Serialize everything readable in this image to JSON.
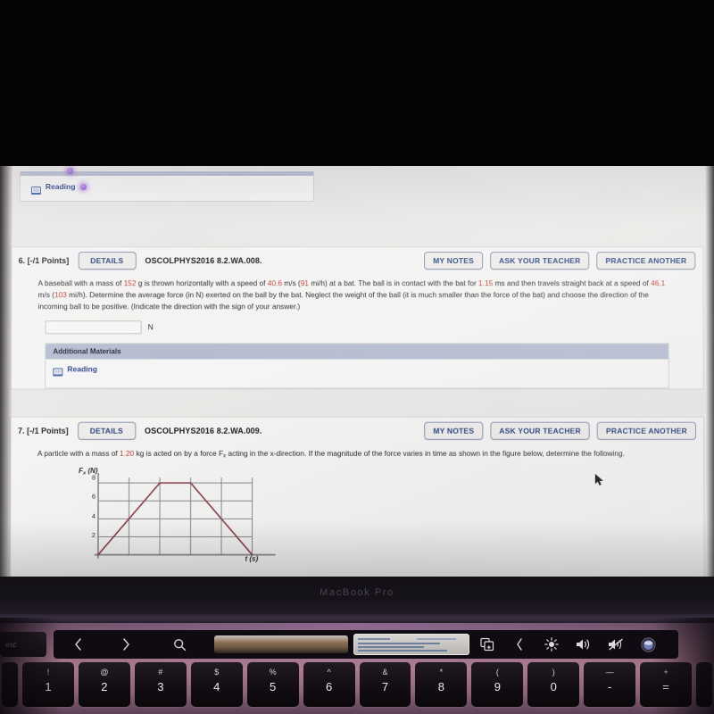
{
  "device": {
    "brand_text": "MacBook Pro",
    "esc_key": "esc"
  },
  "top_partial_card": {
    "reading_label": "Reading",
    "reading_icon": "book-icon"
  },
  "problems": [
    {
      "number": "6.",
      "points": "[-/1 Points]",
      "details_label": "DETAILS",
      "problem_id": "OSCOLPHYS2016 8.2.WA.008.",
      "buttons": [
        "MY NOTES",
        "ASK YOUR TEACHER",
        "PRACTICE ANOTHER"
      ],
      "text_parts": [
        {
          "t": "A baseball with a mass of ",
          "red": false
        },
        {
          "t": "152",
          "red": true
        },
        {
          "t": " g is thrown horizontally with a speed of ",
          "red": false
        },
        {
          "t": "40.6",
          "red": true
        },
        {
          "t": " m/s (",
          "red": false
        },
        {
          "t": "91",
          "red": true
        },
        {
          "t": " mi/h) at a bat. The ball is in contact with the bat for ",
          "red": false
        },
        {
          "t": "1.15",
          "red": true
        },
        {
          "t": " ms and then travels straight back at a speed of ",
          "red": false
        },
        {
          "t": "46.1",
          "red": true
        },
        {
          "t": " m/s (",
          "red": false
        },
        {
          "t": "103",
          "red": true
        },
        {
          "t": " mi/h). Determine the average force (in N) exerted on the ball by the bat. Neglect the weight of the ball (it is much smaller than the force of the bat) and choose the direction of the incoming ball to be positive. (Indicate the direction with the sign of your answer.)",
          "red": false
        }
      ],
      "answer_value": "",
      "answer_placeholder": "",
      "answer_unit": "N",
      "additional_materials_label": "Additional Materials",
      "reading_label": "Reading"
    },
    {
      "number": "7.",
      "points": "[-/1 Points]",
      "details_label": "DETAILS",
      "problem_id": "OSCOLPHYS2016 8.2.WA.009.",
      "buttons": [
        "MY NOTES",
        "ASK YOUR TEACHER",
        "PRACTICE ANOTHER"
      ],
      "text_parts": [
        {
          "t": "A particle with a mass of ",
          "red": false
        },
        {
          "t": "1.20",
          "red": true
        },
        {
          "t": " kg is acted on by a force F",
          "red": false
        },
        {
          "t": "x",
          "red": false,
          "sub": true
        },
        {
          "t": " acting in the x-direction. If the magnitude of the force varies in time as shown in the figure below, determine the following.",
          "red": false
        }
      ]
    }
  ],
  "chart_data": {
    "type": "line",
    "title": "",
    "xlabel": "t (s)",
    "ylabel": "F_x (N)",
    "x": [
      0,
      2,
      3,
      5
    ],
    "y": [
      0,
      8,
      8,
      0
    ],
    "ytick_labels": [
      "8",
      "6",
      "4",
      "2"
    ],
    "ytick_values": [
      8,
      6,
      4,
      2
    ],
    "ylim": [
      0,
      8.6
    ],
    "xlim": [
      0,
      5
    ],
    "grid": true,
    "grid_x_count": 5,
    "grid_y_count": 4,
    "series_color": "#8c3a47",
    "legend": "none",
    "annotations": []
  },
  "touchbar": {
    "back_icon": "chevron-left-icon",
    "forward_icon": "chevron-right-icon",
    "search_icon": "search-icon",
    "address_bar": "",
    "tab_overview_icon": "new-tab-icon",
    "collapse_icon": "chevron-left-icon",
    "brightness_icon": "brightness-icon",
    "volume_up_icon": "volume-up-icon",
    "mute_icon": "volume-mute-icon",
    "siri_icon": "siri-icon"
  },
  "keyboard": {
    "keys": [
      {
        "sym": "!",
        "num": "1"
      },
      {
        "sym": "@",
        "num": "2"
      },
      {
        "sym": "#",
        "num": "3"
      },
      {
        "sym": "$",
        "num": "4"
      },
      {
        "sym": "%",
        "num": "5"
      },
      {
        "sym": "^",
        "num": "6"
      },
      {
        "sym": "&",
        "num": "7"
      },
      {
        "sym": "*",
        "num": "8"
      },
      {
        "sym": "(",
        "num": "9"
      },
      {
        "sym": ")",
        "num": "0"
      },
      {
        "sym": "—",
        "num": "-"
      },
      {
        "sym": "+",
        "num": "="
      }
    ]
  },
  "colors": {
    "accent_blue": "#23407e",
    "value_red": "#c0392b",
    "header_bar": "#b9c0d4",
    "page_bg": "#efeeeb"
  }
}
